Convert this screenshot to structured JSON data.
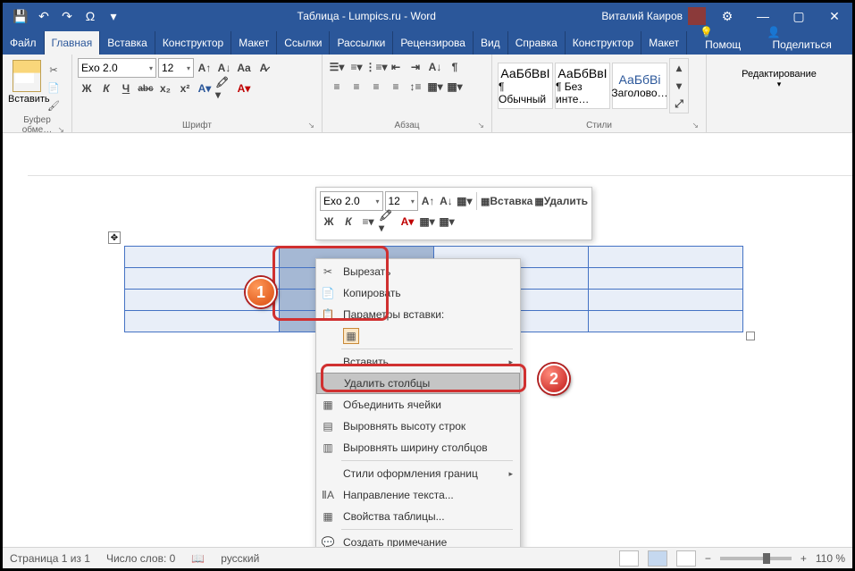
{
  "titlebar": {
    "title": "Таблица - Lumpics.ru - Word",
    "user": "Виталий Каиров"
  },
  "qat": {
    "save": "💾",
    "undo": "↶",
    "redo": "↷",
    "omega": "Ω",
    "more": "▾"
  },
  "tabs": {
    "file": "Файл",
    "home": "Главная",
    "insert": "Вставка",
    "design1": "Конструктор",
    "layout1": "Макет",
    "refs": "Ссылки",
    "mail": "Рассылки",
    "review": "Рецензирова",
    "view": "Вид",
    "help": "Справка",
    "design2": "Конструктор",
    "layout2": "Макет",
    "tell": "Помощ",
    "share": "Поделиться"
  },
  "ribbon": {
    "clipboard": {
      "paste": "Вставить",
      "label": "Буфер обме…"
    },
    "font": {
      "name": "Exo 2.0",
      "size": "12",
      "label": "Шрифт",
      "bold": "Ж",
      "italic": "К",
      "underline": "Ч",
      "strike": "abc",
      "sub": "x₂",
      "sup": "x²"
    },
    "para": {
      "label": "Абзац"
    },
    "styles": {
      "label": "Стили",
      "s1": "АаБбВвІ",
      "s1n": "¶ Обычный",
      "s2": "АаБбВвІ",
      "s2n": "¶ Без инте…",
      "s3": "АаБбВі",
      "s3n": "Заголово…"
    },
    "edit": {
      "label": "Редактирование"
    }
  },
  "minitool": {
    "font": "Exo 2.0",
    "size": "12",
    "insert": "Вставка",
    "delete": "Удалить"
  },
  "ctx": {
    "cut": "Вырезать",
    "copy": "Копировать",
    "pasteopts": "Параметры вставки:",
    "insert": "Вставить",
    "delcols": "Удалить столбцы",
    "merge": "Объединить ячейки",
    "evenh": "Выровнять высоту строк",
    "evenw": "Выровнять ширину столбцов",
    "borders": "Стили оформления границ",
    "textdir": "Направление текста...",
    "props": "Свойства таблицы...",
    "comment": "Создать примечание"
  },
  "status": {
    "page": "Страница 1 из 1",
    "words": "Число слов: 0",
    "lang": "русский",
    "zoom": "110 %"
  }
}
